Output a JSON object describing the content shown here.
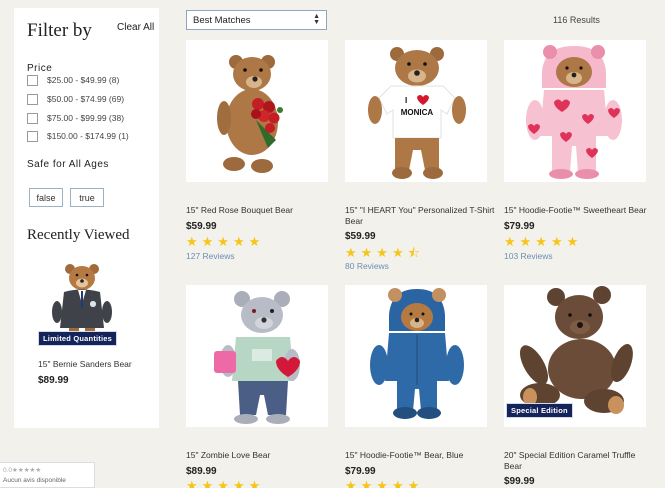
{
  "filters": {
    "title": "Filter by",
    "clear_all": "Clear All",
    "price_title": "Price",
    "price_options": [
      "$25.00 - $49.99 (8)",
      "$50.00 - $74.99 (69)",
      "$75.00 - $99.99 (38)",
      "$150.00 - $174.99 (1)"
    ],
    "age_title": "Safe for All Ages",
    "age_options": [
      "false",
      "true"
    ]
  },
  "recently_viewed": {
    "title": "Recently Viewed",
    "badge": "Limited Quantities",
    "name": "15\" Bernie Sanders Bear",
    "price": "$89.99"
  },
  "sort": {
    "selected": "Best Matches"
  },
  "results_count": "116 Results",
  "products": [
    {
      "name": "15\" Red Rose Bouquet Bear",
      "price": "$59.99",
      "rating": 5,
      "stars": "★★★★★",
      "reviews": "127 Reviews"
    },
    {
      "name": "15\" \"I HEART You\" Personalized T-Shirt Bear",
      "price": "$59.99",
      "rating": 4.5,
      "stars": "★★★★⯪",
      "reviews": "80 Reviews",
      "shirt_line1": "I",
      "shirt_line2": "MONICA"
    },
    {
      "name": "15\" Hoodie-Footie™ Sweetheart Bear",
      "price": "$79.99",
      "rating": 5,
      "stars": "★★★★★",
      "reviews": "103 Reviews"
    },
    {
      "name": "15\" Zombie Love Bear",
      "price": "$89.99",
      "stars": "★★★★★"
    },
    {
      "name": "15\" Hoodie-Footie™ Bear, Blue",
      "price": "$79.99",
      "stars": "★★★★★"
    },
    {
      "name": "20\" Special Edition Caramel Truffle Bear",
      "price": "$99.99",
      "badge": "Special Edition"
    }
  ],
  "rating_widget": {
    "stars": "0.0★★★★★",
    "text": "Aucun avis disponible"
  },
  "colors": {
    "star": "#f5c518",
    "badge_bg": "#14245b",
    "review_link": "#6b8fb3"
  },
  "icons": [
    "select-arrows-icon",
    "checkbox-icon",
    "star-icon"
  ]
}
